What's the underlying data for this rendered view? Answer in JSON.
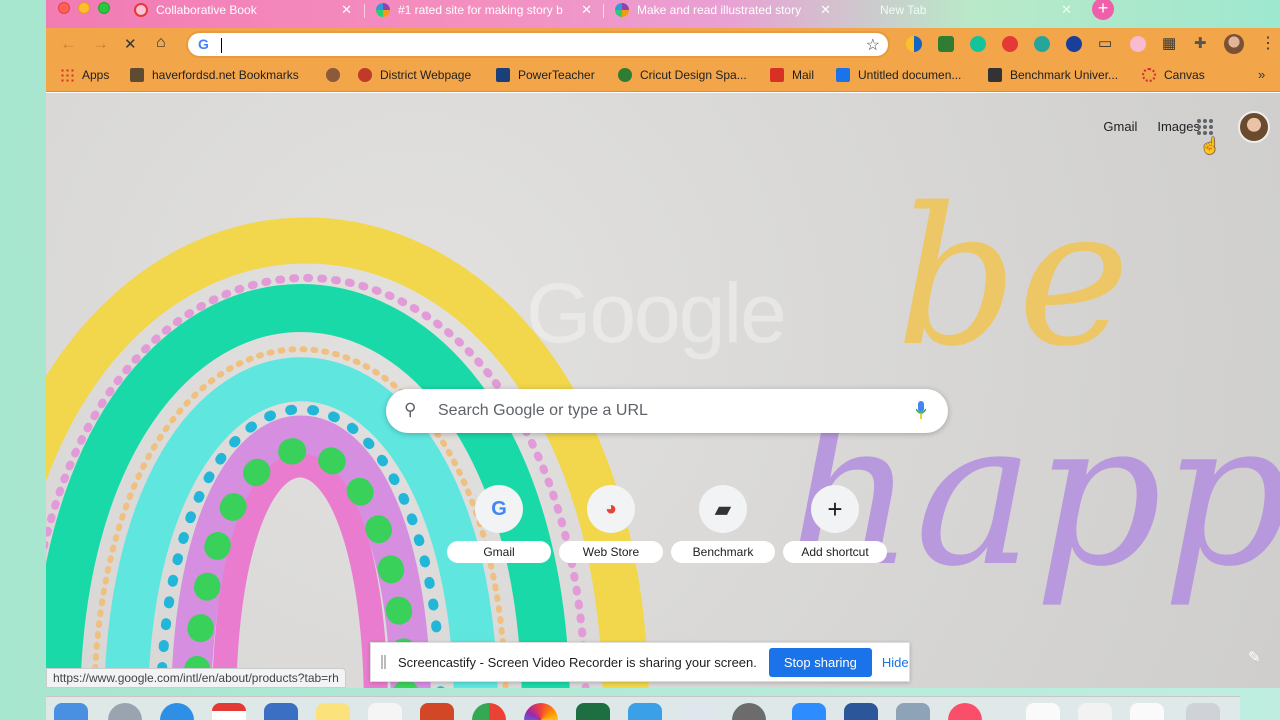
{
  "tabs": [
    {
      "title": "Collaborative Book",
      "favicon_color": "#e53935"
    },
    {
      "title": "#1 rated site for making story b",
      "favicon_color": "#8e44ad"
    },
    {
      "title": "Make and read illustrated story",
      "favicon_color": "#8e44ad"
    },
    {
      "title": "New Tab",
      "favicon_color": ""
    }
  ],
  "omnibox": {
    "value": "",
    "placeholder": ""
  },
  "bookmarks": [
    {
      "label": "Apps",
      "icon": "apps-grid-icon",
      "color": "#d93025"
    },
    {
      "label": "haverfordsd.net Bookmarks",
      "icon": "folder-icon",
      "color": "#5f4b32"
    },
    {
      "label": "",
      "icon": "globe-icon",
      "color": "#8a5a3b"
    },
    {
      "label": "District Webpage",
      "icon": "district-icon",
      "color": "#c0392b"
    },
    {
      "label": "PowerTeacher",
      "icon": "sis-icon",
      "color": "#1a3f7a"
    },
    {
      "label": "Cricut Design Spa...",
      "icon": "cricut-icon",
      "color": "#2e7d32"
    },
    {
      "label": "Mail",
      "icon": "gmail-icon",
      "color": "#d93025"
    },
    {
      "label": "Untitled documen...",
      "icon": "docs-icon",
      "color": "#1a73e8"
    },
    {
      "label": "Benchmark Univer...",
      "icon": "benchmark-icon",
      "color": "#333333"
    },
    {
      "label": "Canvas",
      "icon": "canvas-icon",
      "color": "#d32f2f"
    }
  ],
  "top_links": {
    "gmail": "Gmail",
    "images": "Images"
  },
  "google_logo": "Google",
  "search": {
    "placeholder": "Search Google or type a URL"
  },
  "shortcuts": [
    {
      "label": "Gmail",
      "glyph": "G",
      "color": "#4285f4"
    },
    {
      "label": "Web Store",
      "glyph": "◕",
      "color": "#ea4335"
    },
    {
      "label": "Benchmark",
      "glyph": "▰",
      "color": "#333333"
    },
    {
      "label": "Add shortcut",
      "glyph": "+",
      "color": "#202124"
    }
  ],
  "status_url": "https://www.google.com/intl/en/about/products?tab=rh",
  "sharing_bar": {
    "message": "Screencastify - Screen Video Recorder is sharing your screen.",
    "stop_label": "Stop sharing",
    "hide_label": "Hide"
  },
  "background": {
    "handwritten_text_1": "be",
    "handwritten_text_2": "happy"
  },
  "colors": {
    "tab_strip": "#f27bb4",
    "toolbar": "#f3a54a",
    "accent": "#1a73e8"
  }
}
